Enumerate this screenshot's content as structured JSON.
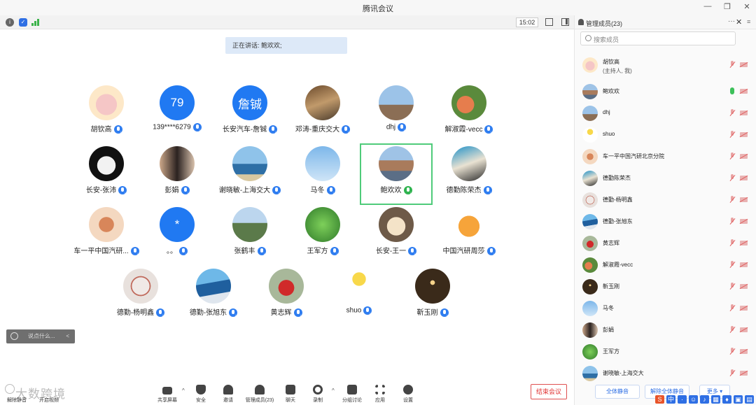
{
  "window": {
    "title": "腾讯会议"
  },
  "meeting": {
    "time": "15:02",
    "speaking": "正在讲话: 鲍欢欢;"
  },
  "participants": [
    {
      "name": "胡钦高",
      "avatar": "pig-cartoon"
    },
    {
      "name": "139****6279",
      "avatar_text": "79"
    },
    {
      "name": "长安汽车-詹铖",
      "avatar_text": "詹铖"
    },
    {
      "name": "邓涛-重庆交大",
      "avatar": "street-photo"
    },
    {
      "name": "dhj",
      "avatar": "sky-photo"
    },
    {
      "name": "解淑霞-vecc",
      "avatar": "peach-photo"
    },
    {
      "name": "长安-张沛",
      "avatar": "panda-photo"
    },
    {
      "name": "彭娟",
      "avatar": "woman-photo"
    },
    {
      "name": "谢晓敏-上海交大",
      "avatar": "sea-photo"
    },
    {
      "name": "马冬",
      "avatar": "eiffel-photo"
    },
    {
      "name": "鲍欢欢",
      "avatar": "landscape-photo",
      "speaking": true
    },
    {
      "name": "德勤陈荣杰",
      "avatar": "man-photo"
    },
    {
      "name": "车一平中国汽研...",
      "avatar": "lady-photo"
    },
    {
      "name": "。。",
      "avatar_text": "*"
    },
    {
      "name": "张鹤丰",
      "avatar": "campus-photo"
    },
    {
      "name": "王军方",
      "avatar": "leaf-photo"
    },
    {
      "name": "长安-王一",
      "avatar": "cartoon-face"
    },
    {
      "name": "中国汽研周莎",
      "avatar": "tiger-cartoon"
    },
    {
      "name": "德勤-杨明鑫",
      "avatar": "seal-logo"
    },
    {
      "name": "德勤-张旭东",
      "avatar": "beach-photo"
    },
    {
      "name": "黄志辉",
      "avatar": "red-dress-photo"
    },
    {
      "name": "shuo",
      "avatar": "emoji-balloon"
    },
    {
      "name": "靳玉刚",
      "avatar": "lights-photo"
    }
  ],
  "chat": {
    "placeholder": "说点什么...",
    "arrow": "<"
  },
  "toolbar": {
    "unmute": "解除静音",
    "video": "开启视频",
    "share": "共享屏幕",
    "security": "安全",
    "invite": "邀请",
    "manage": "管理成员(23)",
    "chat": "聊天",
    "record": "录制",
    "breakout": "分组讨论",
    "apps": "应用",
    "settings": "设置",
    "end": "结束会议"
  },
  "watermark": "大数跨境",
  "panel": {
    "title": "管理成员(23)",
    "search_placeholder": "搜索成员",
    "members": [
      {
        "name": "胡钦高",
        "sub": "(主持人, 我)"
      },
      {
        "name": "鲍欢欢",
        "mic_on": true
      },
      {
        "name": "dhj"
      },
      {
        "name": "shuo"
      },
      {
        "name": "车一平中国汽研北京分院"
      },
      {
        "name": "德勤陈荣杰"
      },
      {
        "name": "德勤-杨明鑫"
      },
      {
        "name": "德勤-张旭东"
      },
      {
        "name": "黄志辉"
      },
      {
        "name": "解淑霞-vecc"
      },
      {
        "name": "靳玉刚"
      },
      {
        "name": "马冬"
      },
      {
        "name": "彭娟"
      },
      {
        "name": "王军方"
      },
      {
        "name": "谢晓敏-上海交大"
      }
    ],
    "buttons": {
      "mute_all": "全体静音",
      "unmute_all": "解除全体静音",
      "more": "更多"
    }
  },
  "tray": [
    "S",
    "中",
    "·",
    "☺",
    "♪",
    "▦",
    "♦",
    "▣",
    "▤"
  ],
  "colors": {
    "accent": "#2f7df0",
    "speaking_border": "#4fcb7a",
    "end_red": "#e03333"
  }
}
